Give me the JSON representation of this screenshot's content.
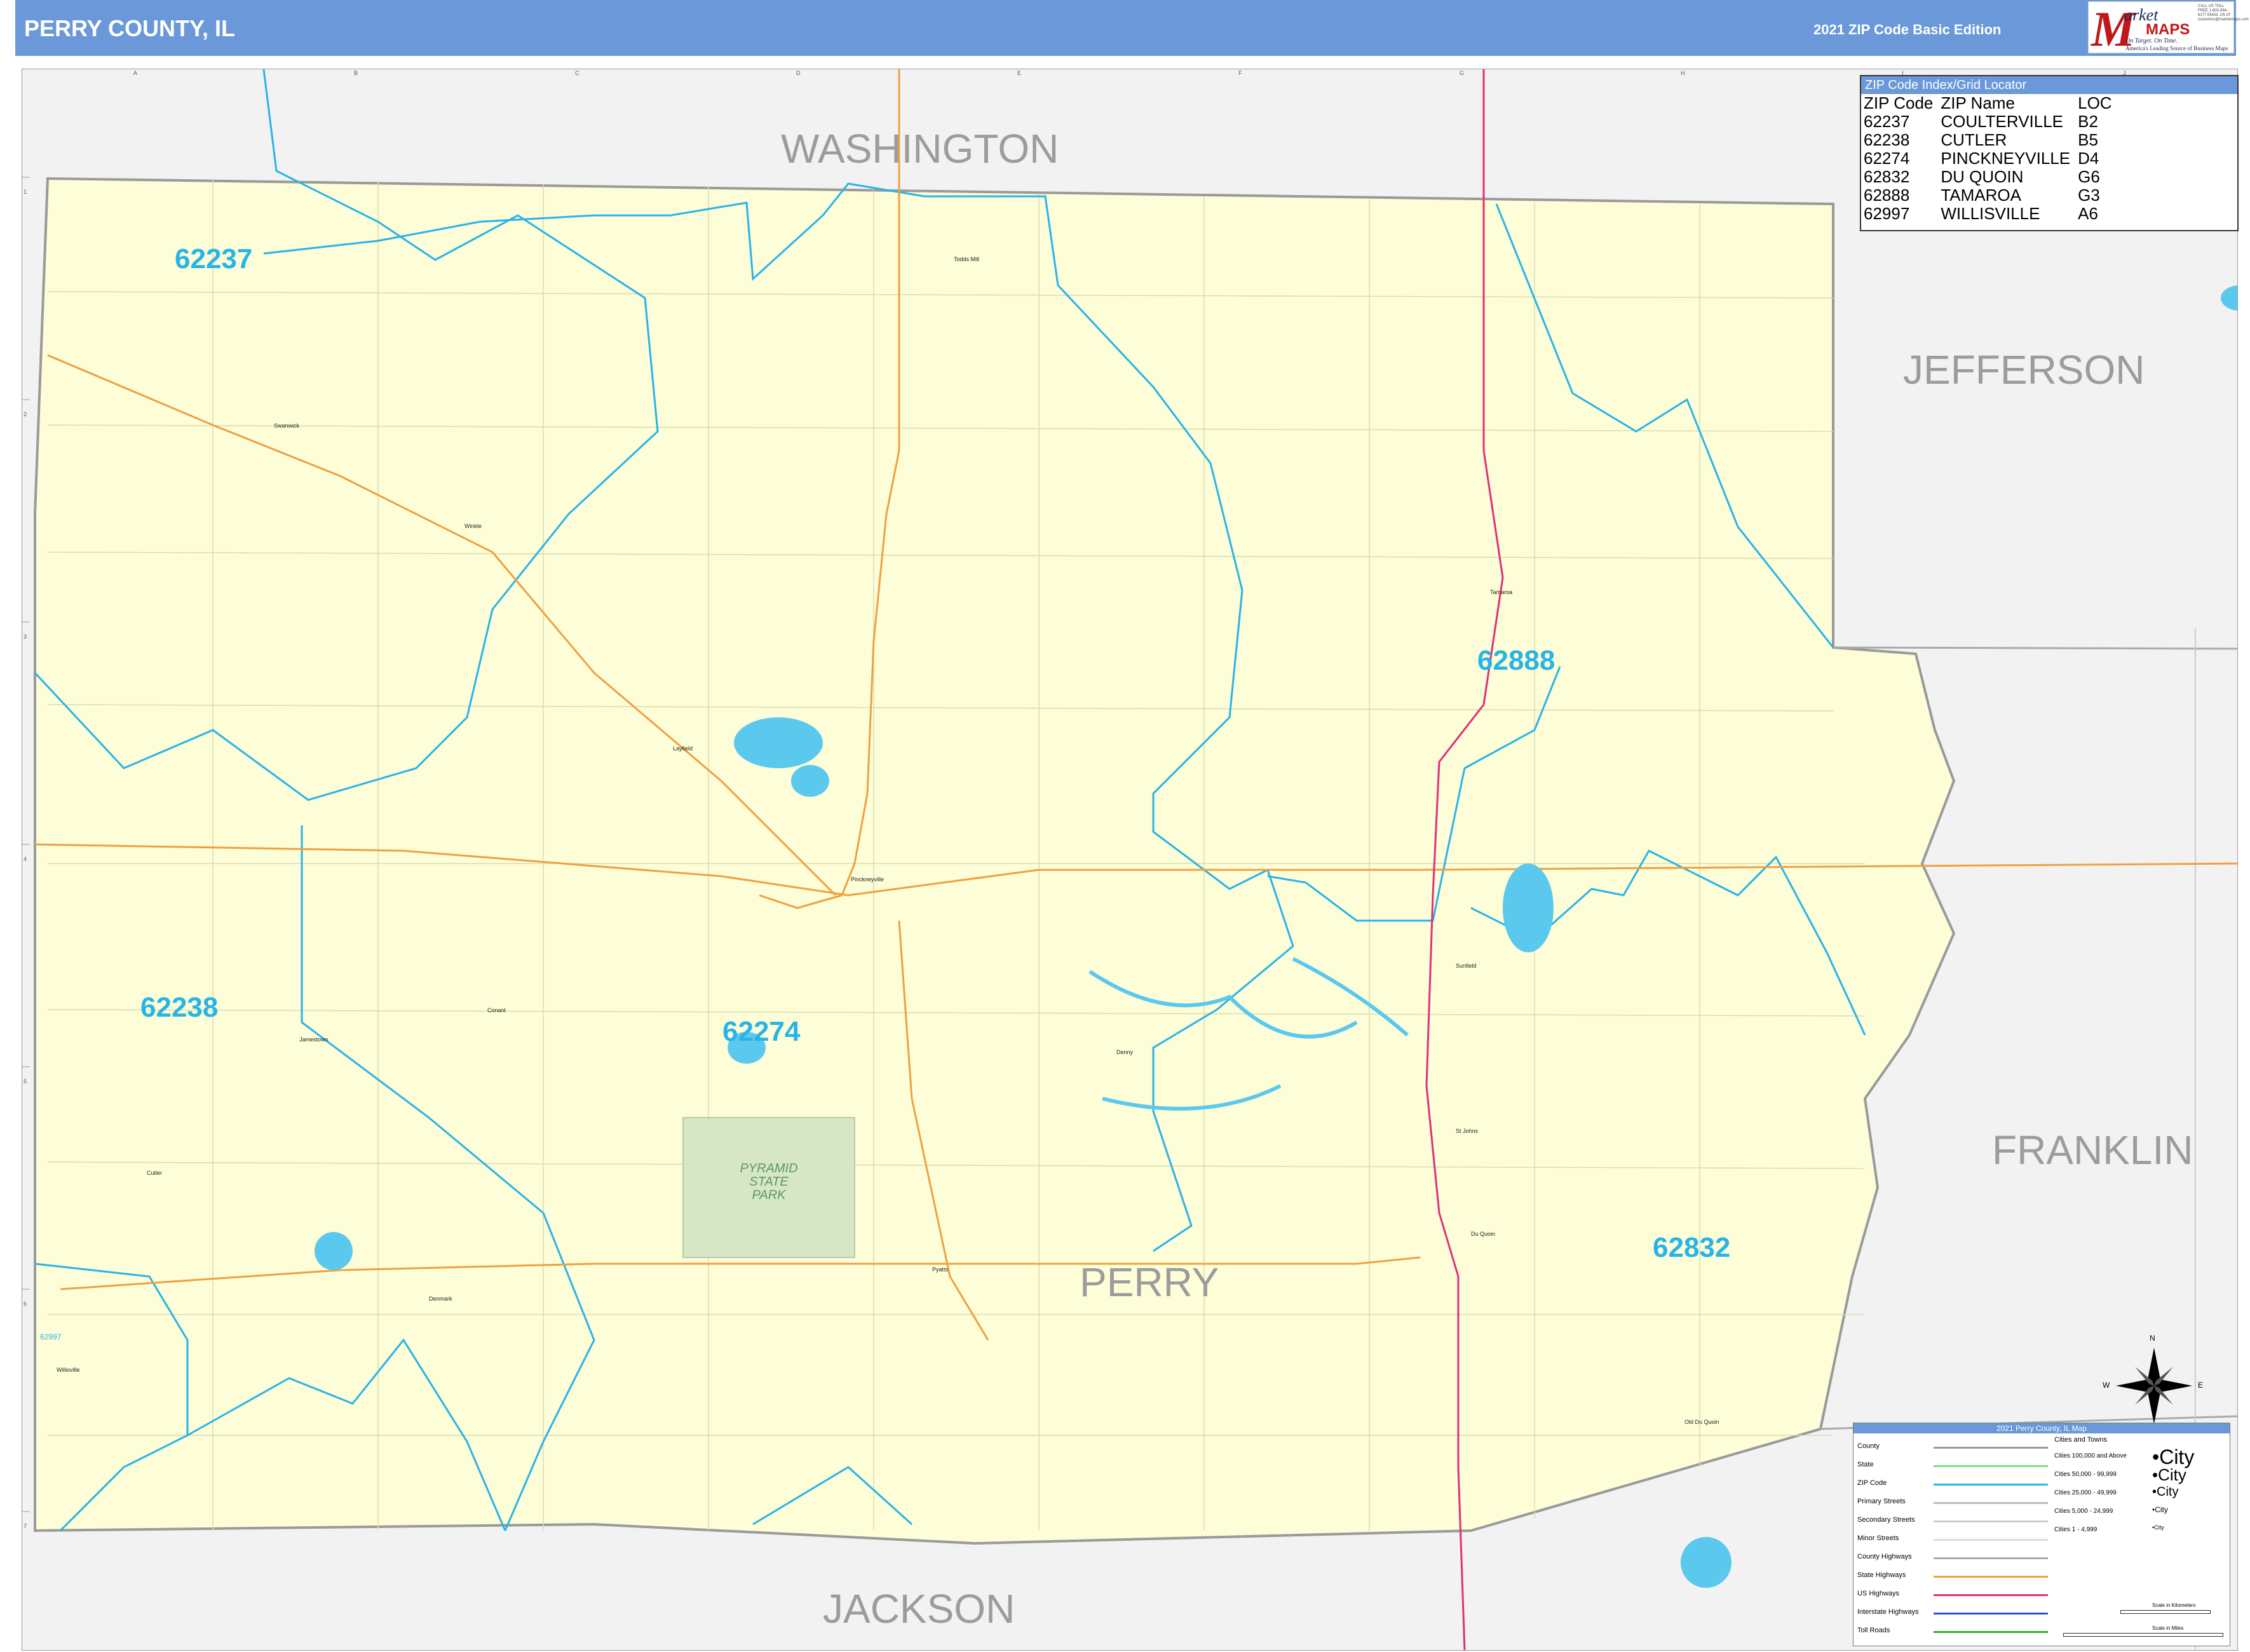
{
  "header": {
    "title": "PERRY COUNTY, IL",
    "edition": "2021 ZIP Code Basic Edition"
  },
  "logo": {
    "m": "M",
    "arket": "arket",
    "maps": "MAPS",
    "tagline": "On Target. On Time.",
    "subtagline": "America's Leading Source of Business Maps",
    "contact": "CALL US TOLL FREE 1-800-994-6277 EMAIL US AT customers@marketmaps.com"
  },
  "counties": {
    "washington": "WASHINGTON",
    "jefferson": "JEFFERSON",
    "franklin": "FRANKLIN",
    "jackson": "JACKSON",
    "perry": "PERRY"
  },
  "zip_labels": {
    "z62237": "62237",
    "z62238": "62238",
    "z62274": "62274",
    "z62888": "62888",
    "z62832": "62832",
    "z62997": "62997"
  },
  "towns": {
    "todds_mill": "Todds Mill",
    "swanwick": "Swanwick",
    "winkle": "Winkle",
    "layfield": "Layfield",
    "pinckneyville": "Pinckneyville",
    "tamaroa": "Tamaroa",
    "conant": "Conant",
    "jamestown": "Jamestown",
    "cutler": "Cutler",
    "denny": "Denny",
    "sunfield": "Sunfield",
    "st_johns": "St Johns",
    "du_quoin": "Du Quoin",
    "pyatts": "Pyatts",
    "denmark": "Denmark",
    "willisville": "Willisville",
    "old_du_quoin": "Old Du Quoin"
  },
  "park": {
    "line1": "PYRAMID",
    "line2": "STATE",
    "line3": "PARK"
  },
  "grid": {
    "columns": [
      "A",
      "B",
      "C",
      "D",
      "E",
      "F",
      "G",
      "H",
      "I",
      "J"
    ],
    "rows": [
      "1",
      "2",
      "3",
      "4",
      "5",
      "6",
      "7"
    ]
  },
  "compass": {
    "n": "N",
    "s": "S",
    "e": "E",
    "w": "W"
  },
  "zip_index": {
    "title": "ZIP Code Index/Grid Locator",
    "headers": [
      "ZIP Code",
      "ZIP Name",
      "LOC"
    ],
    "rows": [
      [
        "62237",
        "COULTERVILLE",
        "B2"
      ],
      [
        "62238",
        "CUTLER",
        "B5"
      ],
      [
        "62274",
        "PINCKNEYVILLE",
        "D4"
      ],
      [
        "62832",
        "DU QUOIN",
        "G6"
      ],
      [
        "62888",
        "TAMAROA",
        "G3"
      ],
      [
        "62997",
        "WILLISVILLE",
        "A6"
      ]
    ]
  },
  "legend": {
    "title": "2021 Perry County, IL Map",
    "items": [
      "County",
      "State",
      "ZIP Code",
      "Primary Streets",
      "Secondary Streets",
      "Minor Streets",
      "County Highways",
      "State Highways",
      "US Highways",
      "Interstate Highways",
      "Toll Roads"
    ],
    "cities_title": "Cities and Towns",
    "cities": [
      "Cities 100,000 and Above",
      "Cities 50,000 - 99,999",
      "Cities 25,000 - 49,999",
      "Cities 5,000 - 24,999",
      "Cities 1 - 4,999"
    ],
    "city_word": "City",
    "scale_km": "Scale in Kilometers",
    "scale_mi": "Scale in Miles",
    "colors": {
      "county": "#999999",
      "state": "#7be07b",
      "zip": "#28b4e8",
      "primary": "#bbbbbb",
      "secondary": "#cccccc",
      "minor": "#dddddd",
      "county_hwy": "#aaaaaa",
      "state_hwy": "#f0a040",
      "us_hwy": "#e0307a",
      "interstate": "#3050c8",
      "toll": "#30b030"
    }
  }
}
